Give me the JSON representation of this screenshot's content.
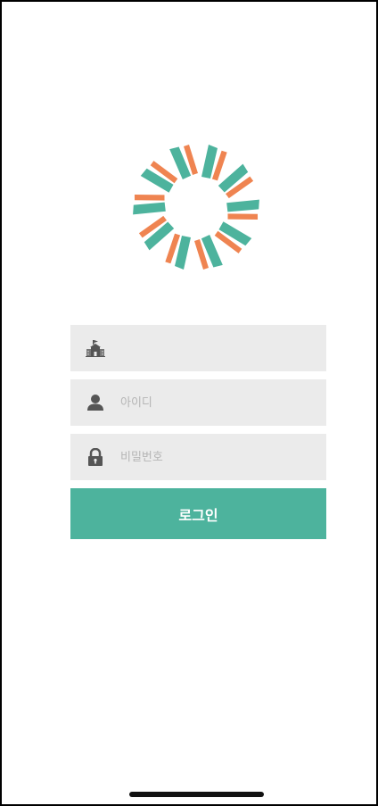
{
  "login_form": {
    "school_field": {
      "icon": "school-building-icon",
      "value": "",
      "placeholder": ""
    },
    "id_field": {
      "icon": "user-icon",
      "value": "",
      "placeholder": "아이디"
    },
    "password_field": {
      "icon": "lock-icon",
      "value": "",
      "placeholder": "비밀번호"
    },
    "login_button_label": "로그인"
  },
  "colors": {
    "accent": "#4db39d",
    "logo_teal": "#4db39d",
    "logo_orange": "#ef8451",
    "field_bg": "#ebebeb",
    "icon_gray": "#555555"
  }
}
